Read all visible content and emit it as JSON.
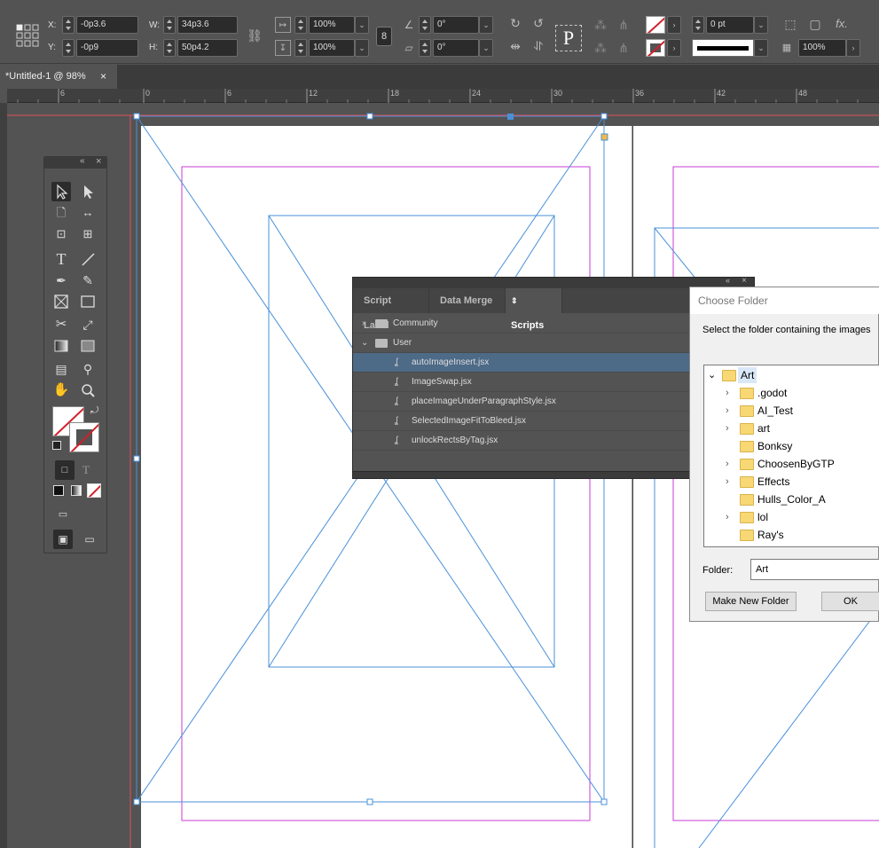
{
  "control_bar": {
    "x_label": "X:",
    "x_value": "-0p3.6",
    "y_label": "Y:",
    "y_value": "-0p9",
    "w_label": "W:",
    "w_value": "34p3.6",
    "h_label": "H:",
    "h_value": "50p4.2",
    "scale_x": "100%",
    "scale_y": "100%",
    "rotate": "0°",
    "shear": "0°",
    "stroke_weight": "0 pt",
    "opacity": "100%"
  },
  "document_tab": {
    "title": "*Untitled-1 @ 98%",
    "close": "×"
  },
  "ruler": {
    "ticks": [
      "6",
      "0",
      "6",
      "12",
      "18",
      "24",
      "30",
      "36",
      "42",
      "48"
    ]
  },
  "tools_panel": {
    "collapse": "«",
    "close": "×"
  },
  "scripts_panel": {
    "collapse": "«",
    "close": "×",
    "tabs": [
      "Script Label",
      "Data Merge",
      "Scripts"
    ],
    "active_tab": "Scripts",
    "folders": [
      "Community",
      "User"
    ],
    "scripts": [
      "autoImageInsert.jsx",
      "ImageSwap.jsx",
      "placeImageUnderParagraphStyle.jsx",
      "SelectedImageFitToBleed.jsx",
      "unlockRectsByTag.jsx"
    ]
  },
  "dialog": {
    "title": "Choose Folder",
    "instruction": "Select the folder containing the images",
    "tree": [
      {
        "name": "Art",
        "expanded": true
      },
      {
        "name": ".godot",
        "has_children": true
      },
      {
        "name": "AI_Test",
        "has_children": true
      },
      {
        "name": "art",
        "has_children": true
      },
      {
        "name": "Bonksy",
        "has_children": false
      },
      {
        "name": "ChoosenByGTP",
        "has_children": true
      },
      {
        "name": "Effects",
        "has_children": true
      },
      {
        "name": "Hulls_Color_A",
        "has_children": false
      },
      {
        "name": "lol",
        "has_children": true
      },
      {
        "name": "Ray's",
        "has_children": false
      }
    ],
    "folder_label": "Folder:",
    "folder_value": "Art",
    "make_folder_button": "Make New Folder",
    "ok_button": "OK"
  },
  "colors": {
    "selection": "#4a90d9",
    "margin": "#c83dd6",
    "bleed": "#e0505a"
  }
}
